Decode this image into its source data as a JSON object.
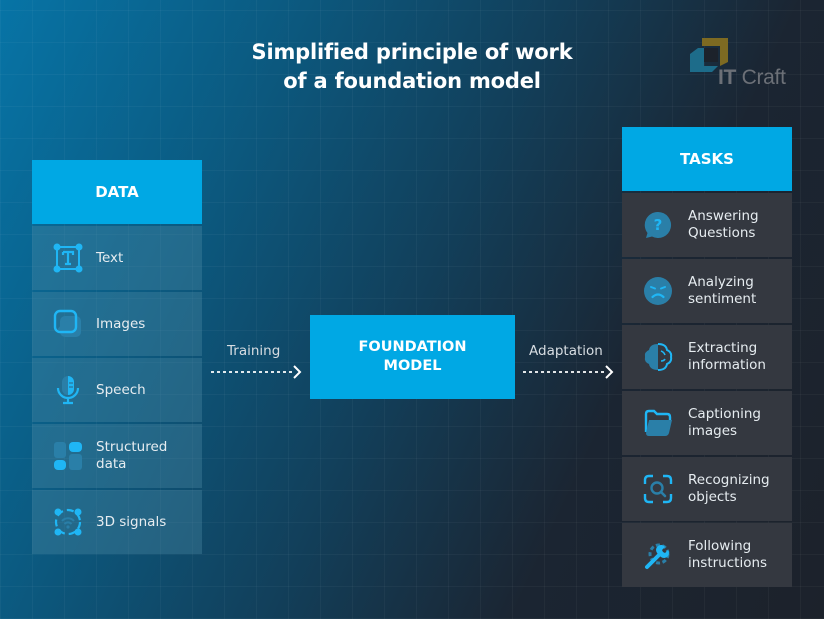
{
  "title": "Simplified principle of work\nof a foundation model",
  "logo": {
    "bold": "IT",
    "text": " Craft"
  },
  "data_column": {
    "header": "DATA",
    "items": [
      {
        "label": "Text",
        "icon": "text-box-icon"
      },
      {
        "label": "Images",
        "icon": "images-icon"
      },
      {
        "label": "Speech",
        "icon": "microphone-icon"
      },
      {
        "label": "Structured\ndata",
        "icon": "grid-blocks-icon"
      },
      {
        "label": "3D signals",
        "icon": "signal-network-icon"
      }
    ]
  },
  "center": {
    "training_label": "Training",
    "model_label": "FOUNDATION\nMODEL",
    "adaptation_label": "Adaptation"
  },
  "tasks_column": {
    "header": "TASKS",
    "items": [
      {
        "label": "Answering\nQuestions",
        "icon": "question-bubble-icon"
      },
      {
        "label": "Analyzing\nsentiment",
        "icon": "sad-face-icon"
      },
      {
        "label": "Extracting\ninformation",
        "icon": "brain-icon"
      },
      {
        "label": "Captioning\nimages",
        "icon": "folder-icon"
      },
      {
        "label": "Recognizing\nobjects",
        "icon": "scan-search-icon"
      },
      {
        "label": "Following\ninstructions",
        "icon": "gear-wrench-icon"
      }
    ]
  },
  "colors": {
    "accent": "#00a8e4",
    "icon_light": "#1fb6f5",
    "icon_dark": "#2a7fa8"
  }
}
